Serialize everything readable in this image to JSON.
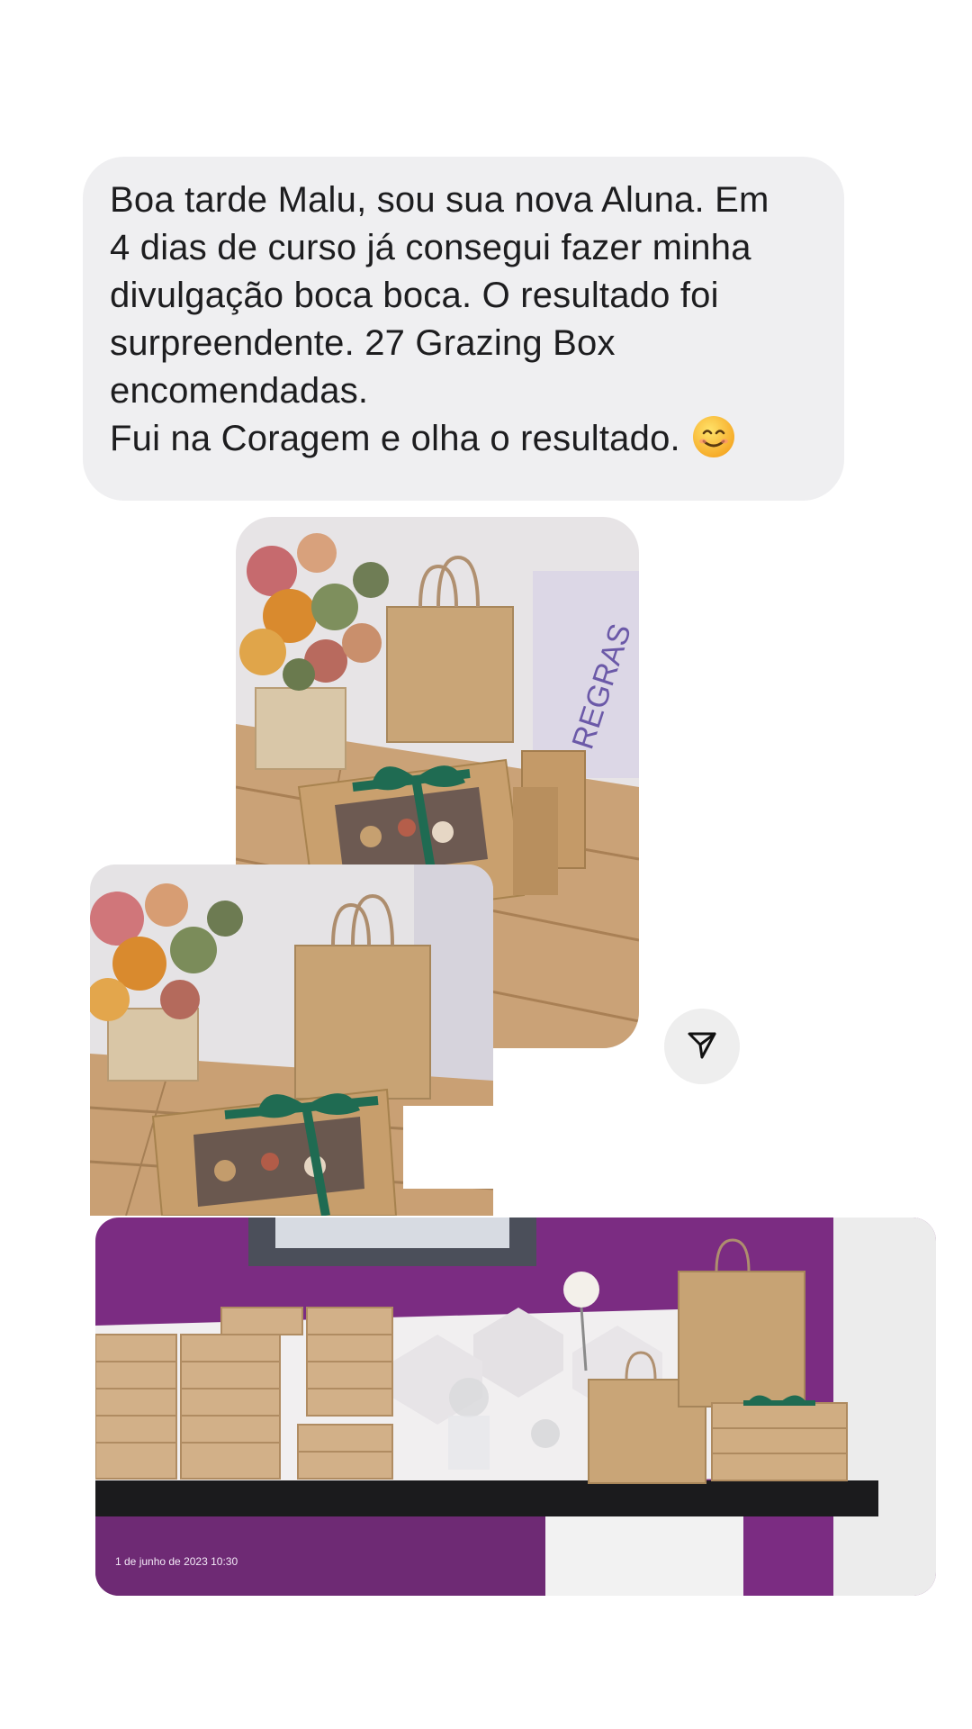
{
  "message": {
    "lines": [
      "Boa tarde Malu, sou sua nova Aluna. Em",
      "4 dias de curso já consegui fazer minha",
      "divulgação boca boca. O resultado foi",
      "surpreendente. 27 Grazing Box",
      "encomendadas.",
      "Fui na Coragem e olha o resultado."
    ],
    "emoji_icon": "smiling-face-icon"
  },
  "photos": [
    {
      "description_icon": "photo-flowers-bag-box",
      "sign_text": "REGRAS"
    },
    {
      "description_icon": "photo-flowers-bag-box-duplicate"
    },
    {
      "description_icon": "photo-packed-boxes-counter",
      "timestamp": "1 de junho de 2023 10:30"
    }
  ],
  "share_button": {
    "icon": "send-icon"
  },
  "colors": {
    "bubble": "#efeff1",
    "text": "#1d1d1f",
    "wall_purple": "#7a2a80",
    "kraft": "#c9a577",
    "ribbon_green": "#1f6b52"
  }
}
